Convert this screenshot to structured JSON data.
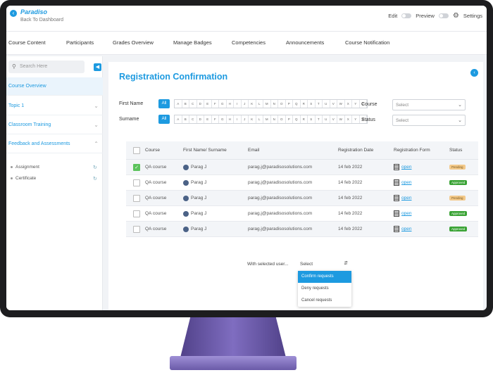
{
  "header": {
    "logo": "Paradiso",
    "back_link": "Back To Dashboard",
    "edit_label": "Edit",
    "preview_label": "Preview",
    "settings_label": "Settings"
  },
  "tabs": [
    "Course Content",
    "Participants",
    "Grades Overview",
    "Manage Badges",
    "Competencies",
    "Announcements",
    "Course Notification"
  ],
  "sidebar": {
    "search_placeholder": "Search Here",
    "items": [
      {
        "label": "Course Overview"
      },
      {
        "label": "Topic 1"
      },
      {
        "label": "Classroom Training"
      },
      {
        "label": "Feedback and Assessments"
      }
    ],
    "sub_items": [
      "Assignment",
      "Certificate"
    ]
  },
  "main": {
    "title": "Registration Confirmation",
    "filters": {
      "first_name_label": "First Name",
      "surname_label": "Surname",
      "all_label": "All",
      "letters": [
        "A",
        "B",
        "C",
        "D",
        "E",
        "F",
        "G",
        "H",
        "I",
        "J",
        "K",
        "L",
        "M",
        "N",
        "O",
        "P",
        "Q",
        "R",
        "S",
        "T",
        "U",
        "V",
        "W",
        "X",
        "Y",
        "Z"
      ],
      "course_label": "Course",
      "course_placeholder": "Select",
      "status_label": "Status",
      "status_placeholder": "Select"
    },
    "table": {
      "headers": [
        "Course",
        "First Name/ Surname",
        "Email",
        "Registration Date",
        "Registration Form",
        "Status"
      ],
      "rows": [
        {
          "course": "QA course",
          "name": "Parag J",
          "email": "parag.j@paradisosolutions.com",
          "date": "14 feb 2022",
          "form": "open",
          "status": "Pending",
          "checked": true
        },
        {
          "course": "QA course",
          "name": "Parag J",
          "email": "parag.j@paradisosolutions.com",
          "date": "14 feb 2022",
          "form": "open",
          "status": "Approved",
          "checked": false
        },
        {
          "course": "QA course",
          "name": "Parag J",
          "email": "parag.j@paradisosolutions.com",
          "date": "14 feb 2022",
          "form": "open",
          "status": "Pending",
          "checked": false
        },
        {
          "course": "QA course",
          "name": "Parag J",
          "email": "parag.j@paradisosolutions.com",
          "date": "14 feb 2022",
          "form": "open",
          "status": "Approved",
          "checked": false
        },
        {
          "course": "QA course",
          "name": "Parag J",
          "email": "parag.j@paradisosolutions.com",
          "date": "14 feb 2022",
          "form": "open",
          "status": "Approved",
          "checked": false
        }
      ]
    },
    "bulk": {
      "label": "With selected user...",
      "select_value": "Select",
      "options": [
        "Confirm requests",
        "Deny requests",
        "Cancel requests"
      ]
    }
  },
  "colors": {
    "accent": "#1d9ae0",
    "pending": "#f3c98a",
    "approved": "#3aa335"
  }
}
